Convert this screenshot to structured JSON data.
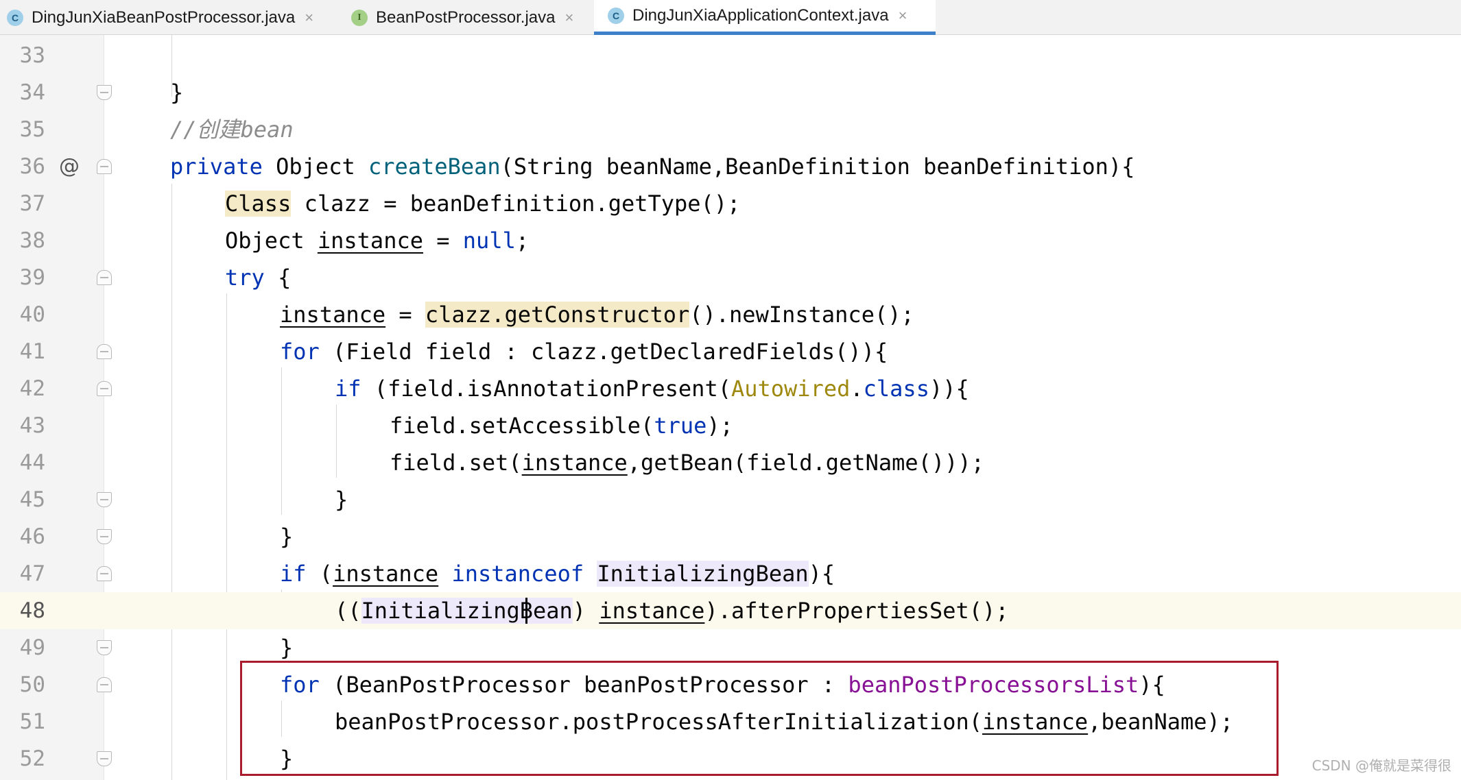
{
  "tabs": [
    {
      "label": "DingJunXiaBeanPostProcessor.java",
      "icon": "C",
      "type": "class",
      "close": "×"
    },
    {
      "label": "BeanPostProcessor.java",
      "icon": "I",
      "type": "interface",
      "close": "×"
    },
    {
      "label": "DingJunXiaApplicationContext.java",
      "icon": "C",
      "type": "class",
      "close": "×"
    }
  ],
  "gutter": {
    "at_symbol": "@"
  },
  "lines": [
    "33",
    "34",
    "35",
    "36",
    "37",
    "38",
    "39",
    "40",
    "41",
    "42",
    "43",
    "44",
    "45",
    "46",
    "47",
    "48",
    "49",
    "50",
    "51",
    "52"
  ],
  "code": {
    "l34": "}",
    "l35": "//创建bean",
    "l36": [
      "private",
      "Object",
      "createBean",
      "(String beanName,BeanDefinition beanDefinition){"
    ],
    "l37": [
      "Class",
      " clazz = beanDefinition.getType();"
    ],
    "l38": [
      "Object ",
      "instance",
      " = ",
      "null",
      ";"
    ],
    "l39": [
      "try",
      " {"
    ],
    "l40": [
      "instance",
      " = ",
      "clazz.getConstructor",
      "().newInstance();"
    ],
    "l41": [
      "for",
      " (Field field : clazz.getDeclaredFields()){"
    ],
    "l42": [
      "if",
      " (field.isAnnotationPresent(",
      "Autowired",
      ".",
      "class",
      ")){"
    ],
    "l43": [
      "field.setAccessible(",
      "true",
      ");"
    ],
    "l44": [
      "field.set(",
      "instance",
      ",getBean(field.getName()));"
    ],
    "l45": "}",
    "l46": "}",
    "l47": [
      "if",
      " (",
      "instance",
      " ",
      "instanceof",
      " ",
      "InitializingBean",
      "){"
    ],
    "l48": [
      "((",
      "InitializingBean",
      ") ",
      "instance",
      ").afterPropertiesSet();"
    ],
    "l49": "}",
    "l50": [
      "for",
      " (BeanPostProcessor beanPostProcessor : ",
      "beanPostProcessorsList",
      "){"
    ],
    "l51": [
      "beanPostProcessor.postProcessAfterInitialization(",
      "instance",
      ",beanName);"
    ],
    "l52": "}"
  },
  "watermark": "CSDN @俺就是菜得很",
  "colors": {
    "keyword": "#0033b3",
    "method": "#00627a",
    "annotation": "#9e880d",
    "field": "#871094",
    "highlight_box": "#a81c2c",
    "active_tab": "#3e7fc9"
  }
}
